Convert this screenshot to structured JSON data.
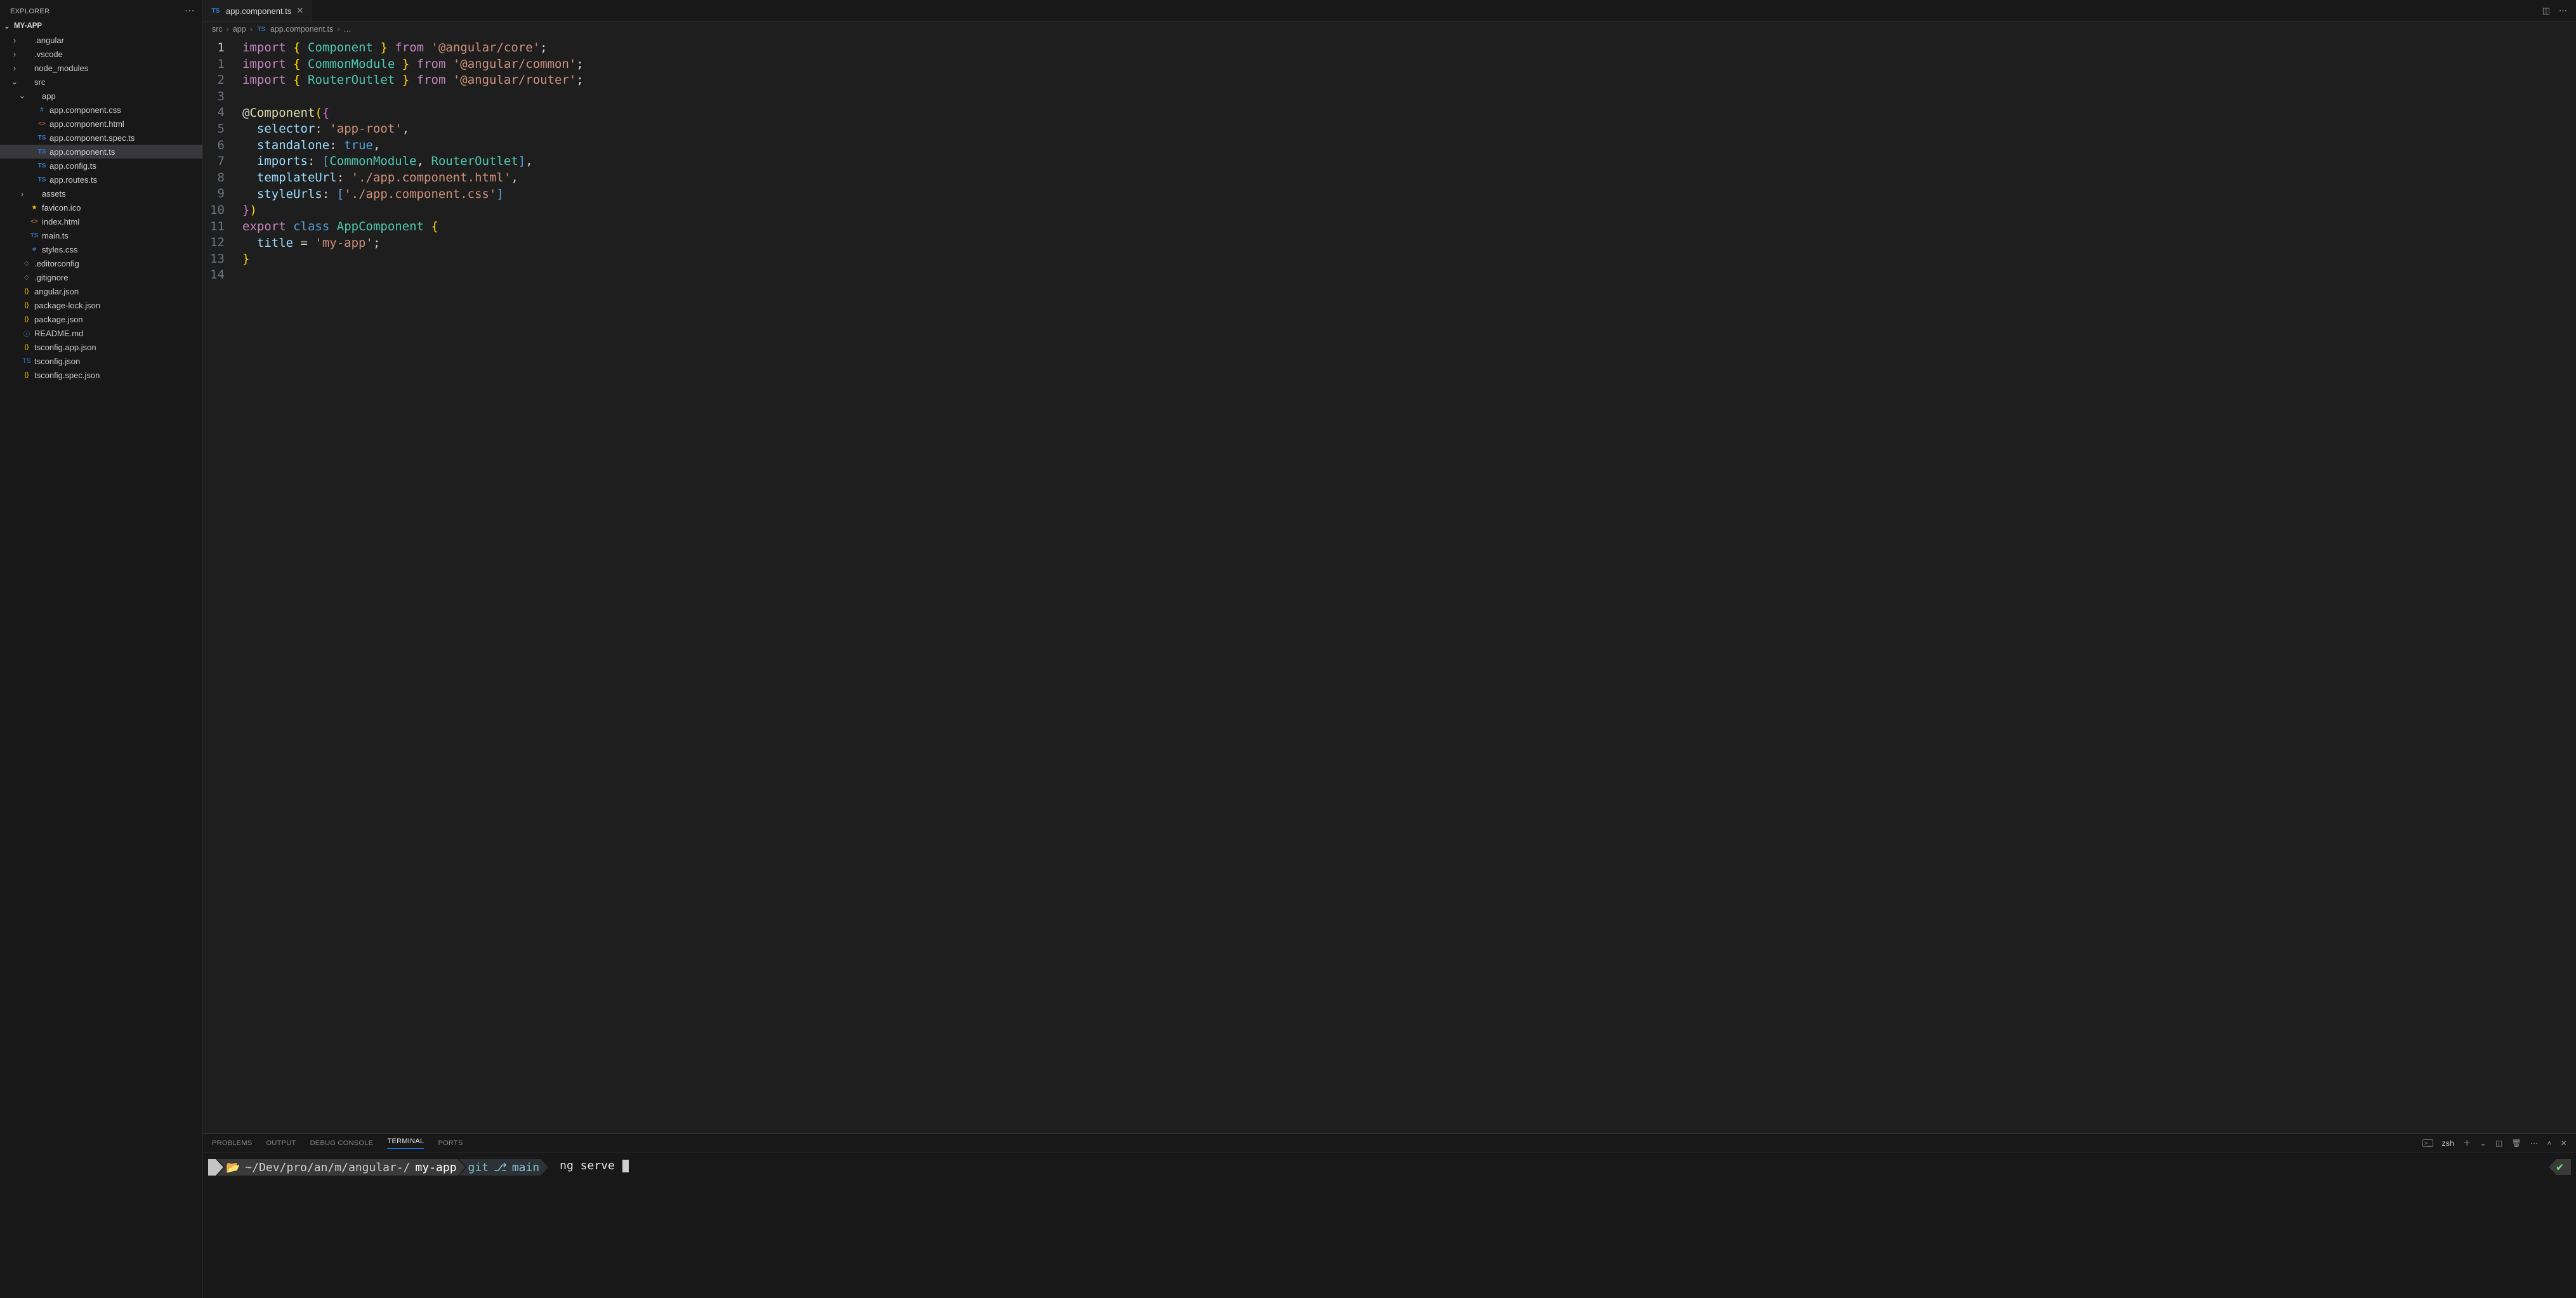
{
  "explorer": {
    "title": "EXPLORER",
    "project": "MY-APP",
    "tree": [
      {
        "depth": 0,
        "kind": "folder",
        "chev": ">",
        "icon": "fold",
        "label": ".angular"
      },
      {
        "depth": 0,
        "kind": "folder",
        "chev": ">",
        "icon": "fold",
        "label": ".vscode"
      },
      {
        "depth": 0,
        "kind": "folder",
        "chev": ">",
        "icon": "fold",
        "label": "node_modules"
      },
      {
        "depth": 0,
        "kind": "folder",
        "chev": "v",
        "icon": "fold",
        "label": "src"
      },
      {
        "depth": 1,
        "kind": "folder",
        "chev": "v",
        "icon": "fold",
        "label": "app"
      },
      {
        "depth": 2,
        "kind": "file",
        "icon": "css",
        "label": "app.component.css"
      },
      {
        "depth": 2,
        "kind": "file",
        "icon": "html",
        "label": "app.component.html"
      },
      {
        "depth": 2,
        "kind": "file",
        "icon": "ts",
        "label": "app.component.spec.ts"
      },
      {
        "depth": 2,
        "kind": "file",
        "icon": "ts",
        "label": "app.component.ts",
        "selected": true
      },
      {
        "depth": 2,
        "kind": "file",
        "icon": "ts",
        "label": "app.config.ts"
      },
      {
        "depth": 2,
        "kind": "file",
        "icon": "ts",
        "label": "app.routes.ts"
      },
      {
        "depth": 1,
        "kind": "folder",
        "chev": ">",
        "icon": "fold",
        "label": "assets"
      },
      {
        "depth": 1,
        "kind": "file",
        "icon": "star",
        "label": "favicon.ico"
      },
      {
        "depth": 1,
        "kind": "file",
        "icon": "html",
        "label": "index.html"
      },
      {
        "depth": 1,
        "kind": "file",
        "icon": "ts",
        "label": "main.ts"
      },
      {
        "depth": 1,
        "kind": "file",
        "icon": "css",
        "label": "styles.css"
      },
      {
        "depth": 0,
        "kind": "file",
        "icon": "gray",
        "label": ".editorconfig"
      },
      {
        "depth": 0,
        "kind": "file",
        "icon": "gray",
        "label": ".gitignore"
      },
      {
        "depth": 0,
        "kind": "file",
        "icon": "json",
        "label": "angular.json"
      },
      {
        "depth": 0,
        "kind": "file",
        "icon": "json",
        "label": "package-lock.json"
      },
      {
        "depth": 0,
        "kind": "file",
        "icon": "json",
        "label": "package.json"
      },
      {
        "depth": 0,
        "kind": "file",
        "icon": "info",
        "label": "README.md"
      },
      {
        "depth": 0,
        "kind": "file",
        "icon": "json",
        "label": "tsconfig.app.json"
      },
      {
        "depth": 0,
        "kind": "file",
        "icon": "tsj",
        "label": "tsconfig.json"
      },
      {
        "depth": 0,
        "kind": "file",
        "icon": "json",
        "label": "tsconfig.spec.json"
      }
    ]
  },
  "tab": {
    "icon": "TS",
    "label": "app.component.ts"
  },
  "breadcrumbs": [
    "src",
    "app",
    "app.component.ts",
    "…"
  ],
  "editor": {
    "lines": [
      [
        {
          "t": "import",
          "c": "kw"
        },
        {
          "t": " "
        },
        {
          "t": "{",
          "c": "yel"
        },
        {
          "t": " "
        },
        {
          "t": "Component",
          "c": "typ"
        },
        {
          "t": " "
        },
        {
          "t": "}",
          "c": "yel"
        },
        {
          "t": " "
        },
        {
          "t": "from",
          "c": "kw"
        },
        {
          "t": " "
        },
        {
          "t": "'@angular/core'",
          "c": "str"
        },
        {
          "t": ";",
          "c": "pun"
        }
      ],
      [
        {
          "t": "import",
          "c": "kw"
        },
        {
          "t": " "
        },
        {
          "t": "{",
          "c": "yel"
        },
        {
          "t": " "
        },
        {
          "t": "CommonModule",
          "c": "typ"
        },
        {
          "t": " "
        },
        {
          "t": "}",
          "c": "yel"
        },
        {
          "t": " "
        },
        {
          "t": "from",
          "c": "kw"
        },
        {
          "t": " "
        },
        {
          "t": "'@angular/common'",
          "c": "str"
        },
        {
          "t": ";",
          "c": "pun"
        }
      ],
      [
        {
          "t": "import",
          "c": "kw"
        },
        {
          "t": " "
        },
        {
          "t": "{",
          "c": "yel"
        },
        {
          "t": " "
        },
        {
          "t": "RouterOutlet",
          "c": "typ"
        },
        {
          "t": " "
        },
        {
          "t": "}",
          "c": "yel"
        },
        {
          "t": " "
        },
        {
          "t": "from",
          "c": "kw"
        },
        {
          "t": " "
        },
        {
          "t": "'@angular/router'",
          "c": "str"
        },
        {
          "t": ";",
          "c": "pun"
        }
      ],
      [],
      [
        {
          "t": "@",
          "c": "pun"
        },
        {
          "t": "Component",
          "c": "fn"
        },
        {
          "t": "(",
          "c": "yel"
        },
        {
          "t": "{",
          "c": "pnk"
        }
      ],
      [
        {
          "t": "  "
        },
        {
          "t": "selector",
          "c": "prop"
        },
        {
          "t": ":",
          "c": "pun"
        },
        {
          "t": " "
        },
        {
          "t": "'app-root'",
          "c": "str"
        },
        {
          "t": ",",
          "c": "pun"
        }
      ],
      [
        {
          "t": "  "
        },
        {
          "t": "standalone",
          "c": "prop"
        },
        {
          "t": ":",
          "c": "pun"
        },
        {
          "t": " "
        },
        {
          "t": "true",
          "c": "blu"
        },
        {
          "t": ",",
          "c": "pun"
        }
      ],
      [
        {
          "t": "  "
        },
        {
          "t": "imports",
          "c": "prop"
        },
        {
          "t": ":",
          "c": "pun"
        },
        {
          "t": " "
        },
        {
          "t": "[",
          "c": "blu"
        },
        {
          "t": "CommonModule",
          "c": "typ"
        },
        {
          "t": ",",
          "c": "pun"
        },
        {
          "t": " "
        },
        {
          "t": "RouterOutlet",
          "c": "typ"
        },
        {
          "t": "]",
          "c": "blu"
        },
        {
          "t": ",",
          "c": "pun"
        }
      ],
      [
        {
          "t": "  "
        },
        {
          "t": "templateUrl",
          "c": "prop"
        },
        {
          "t": ":",
          "c": "pun"
        },
        {
          "t": " "
        },
        {
          "t": "'./app.component.html'",
          "c": "str"
        },
        {
          "t": ",",
          "c": "pun"
        }
      ],
      [
        {
          "t": "  "
        },
        {
          "t": "styleUrls",
          "c": "prop"
        },
        {
          "t": ":",
          "c": "pun"
        },
        {
          "t": " "
        },
        {
          "t": "[",
          "c": "blu"
        },
        {
          "t": "'./app.component.css'",
          "c": "str"
        },
        {
          "t": "]",
          "c": "blu"
        }
      ],
      [
        {
          "t": "}",
          "c": "pnk"
        },
        {
          "t": ")",
          "c": "yel"
        }
      ],
      [
        {
          "t": "export",
          "c": "kw"
        },
        {
          "t": " "
        },
        {
          "t": "class",
          "c": "blu"
        },
        {
          "t": " "
        },
        {
          "t": "AppComponent",
          "c": "typ"
        },
        {
          "t": " "
        },
        {
          "t": "{",
          "c": "yel"
        }
      ],
      [
        {
          "t": "  "
        },
        {
          "t": "title",
          "c": "ident"
        },
        {
          "t": " = ",
          "c": "pun"
        },
        {
          "t": "'my-app'",
          "c": "str"
        },
        {
          "t": ";",
          "c": "pun"
        }
      ],
      [
        {
          "t": "}",
          "c": "yel"
        }
      ],
      []
    ],
    "lineNumbers": [
      "1",
      "1",
      "2",
      "3",
      "4",
      "5",
      "6",
      "7",
      "8",
      "9",
      "10",
      "11",
      "12",
      "13",
      "14"
    ],
    "currentLine": 0
  },
  "panel": {
    "tabs": [
      "PROBLEMS",
      "OUTPUT",
      "DEBUG CONSOLE",
      "TERMINAL",
      "PORTS"
    ],
    "active": 3,
    "shell": "zsh"
  },
  "terminal": {
    "apple": "",
    "pathPrefix": "~/Dev/pro/an/m/angular-/",
    "pathLast": "my-app",
    "gitLabel": "git",
    "branchIcon": "⎇",
    "branch": "main",
    "command": "ng serve",
    "check": "✔"
  }
}
